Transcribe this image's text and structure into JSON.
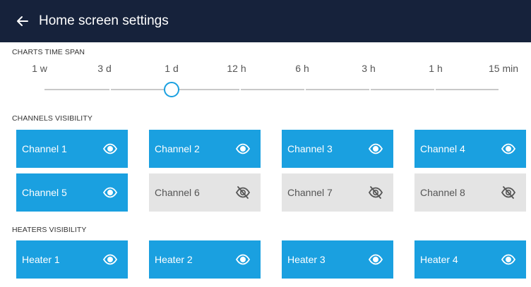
{
  "header": {
    "title": "Home screen settings",
    "back_icon": "arrow-left-icon"
  },
  "time_span": {
    "label": "CHARTS TIME SPAN",
    "options": [
      "1 w",
      "3 d",
      "1 d",
      "12 h",
      "6 h",
      "3 h",
      "1 h",
      "15 min"
    ],
    "selected": "1 d",
    "accent": "#1aa0e0"
  },
  "channels": {
    "label": "CHANNELS VISIBILITY",
    "items": [
      {
        "name": "Channel 1",
        "visible": true
      },
      {
        "name": "Channel 2",
        "visible": true
      },
      {
        "name": "Channel 3",
        "visible": true
      },
      {
        "name": "Channel 4",
        "visible": true
      },
      {
        "name": "Channel 5",
        "visible": true
      },
      {
        "name": "Channel 6",
        "visible": false
      },
      {
        "name": "Channel 7",
        "visible": false
      },
      {
        "name": "Channel 8",
        "visible": false
      }
    ]
  },
  "heaters": {
    "label": "HEATERS VISIBILITY",
    "items": [
      {
        "name": "Heater 1",
        "visible": true
      },
      {
        "name": "Heater 2",
        "visible": true
      },
      {
        "name": "Heater 3",
        "visible": true
      },
      {
        "name": "Heater 4",
        "visible": true
      }
    ]
  },
  "colors": {
    "header_bg": "#16223b",
    "on_bg": "#1aa0e0",
    "off_bg": "#e4e4e4"
  },
  "icons": {
    "visible": "eye-icon",
    "hidden": "eye-off-icon"
  }
}
